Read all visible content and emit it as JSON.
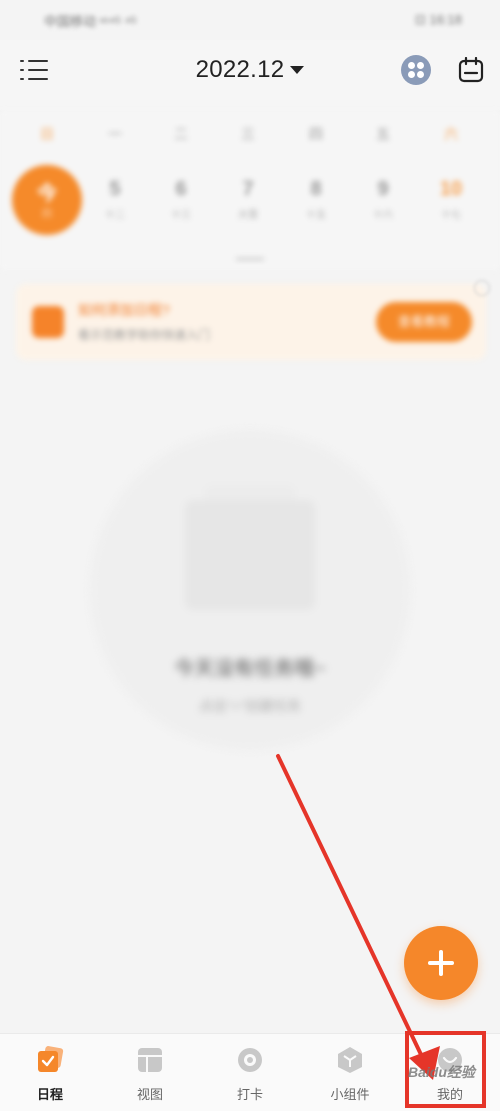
{
  "status_bar": {
    "left": "中国移动 ᵛᵒ⁴ᴳ ⁴ᴳ",
    "right": "⊡ 16:18"
  },
  "header": {
    "month_title": "2022.12"
  },
  "week": {
    "weekday_labels": [
      "日",
      "一",
      "二",
      "三",
      "四",
      "五",
      "六"
    ],
    "today": {
      "label": "今",
      "sub": "四"
    },
    "dates": [
      {
        "num": "5",
        "sub": "十二"
      },
      {
        "num": "6",
        "sub": "十三"
      },
      {
        "num": "7",
        "sub": "大雪"
      },
      {
        "num": "8",
        "sub": "十五"
      },
      {
        "num": "9",
        "sub": "十六"
      },
      {
        "num": "10",
        "sub": "十七"
      }
    ]
  },
  "banner": {
    "title": "如何添加日程?",
    "subtitle": "看示范教学助你快速入门",
    "button": "查看教程"
  },
  "empty_state": {
    "title": "今天没有任务哦~",
    "subtitle": "点击\"+\"创建任务"
  },
  "tabs": [
    {
      "label": "日程",
      "active": true
    },
    {
      "label": "视图",
      "active": false
    },
    {
      "label": "打卡",
      "active": false
    },
    {
      "label": "小组件",
      "active": false
    },
    {
      "label": "我的",
      "active": false
    }
  ],
  "overlay": {
    "watermark": "Baidu经验"
  },
  "colors": {
    "accent": "#f5872a",
    "annotation": "#e53529"
  }
}
